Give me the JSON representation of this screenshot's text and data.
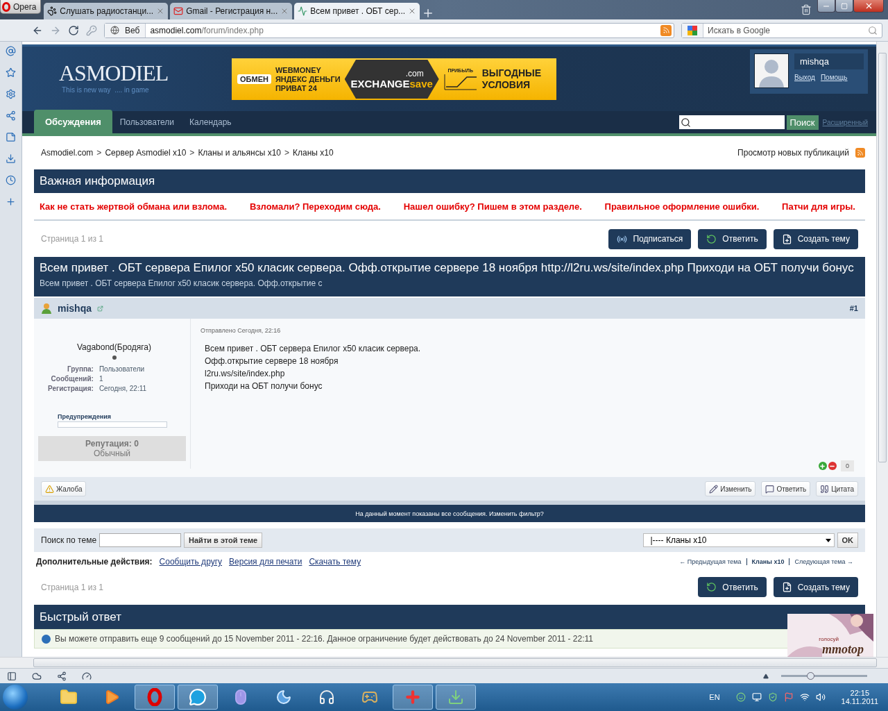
{
  "browser": {
    "opera_label": "Opera",
    "tabs": [
      {
        "title": "Слушать радиостанци...",
        "selected": false
      },
      {
        "title": "Gmail - Регистрация н...",
        "selected": false
      },
      {
        "title": "Всем привет . ОБТ сер...",
        "selected": true
      }
    ],
    "address": {
      "scope": "Веб",
      "domain": "asmodiel.com",
      "path": "/forum/index.php"
    },
    "search_placeholder": "Искать в Google"
  },
  "header": {
    "logo": "ASMODIEL",
    "tagline": "This is new way  .... in game",
    "banner": {
      "tag": "ОБМЕН",
      "lines": [
        "WEBMONEY",
        "ЯНДЕКС ДЕНЬГИ",
        "ПРИВАТ 24"
      ],
      "com": ".com",
      "brand": "EXCHANGE",
      "brand_accent": "save",
      "chart_label": "ПРИБЫЛЬ",
      "offer": [
        "ВЫГОДНЫЕ",
        "УСЛОВИЯ"
      ]
    },
    "user": {
      "name": "mishqa",
      "links": [
        "Выход",
        "Помощь"
      ]
    }
  },
  "nav": {
    "tabs": [
      {
        "label": "Обсуждения",
        "selected": true
      },
      {
        "label": "Пользователи",
        "selected": false
      },
      {
        "label": "Календарь",
        "selected": false
      }
    ],
    "search_button": "Поиск",
    "advanced": "Расширенный"
  },
  "breadcrumbs": [
    {
      "label": "Asmodiel.com"
    },
    {
      "separator": ">",
      "label": "Сервер Asmodiel x10"
    },
    {
      "separator": ">",
      "label": "Кланы и альянсы x10"
    },
    {
      "separator": ">",
      "label": "Кланы x10"
    }
  ],
  "new_posts": "Просмотр новых публикаций",
  "important": {
    "title": "Важная информация",
    "links": [
      "Как не стать жертвой обмана или взлома.",
      "Взломали? Переходим сюда.",
      "Нашел ошибку? Пишем в этом разделе.",
      "Правильное оформление ошибки.",
      "Патчи для игры."
    ]
  },
  "pagination_top": "Страница 1 из 1",
  "top_buttons": [
    {
      "kind": "subscribe",
      "label": "Подписаться"
    },
    {
      "kind": "reply",
      "label": "Ответить"
    },
    {
      "kind": "new",
      "label": "Создать тему"
    }
  ],
  "topic": {
    "title": "Всем привет . ОБТ сервера Епилог х50 класик сервера. Офф.открытие сервере 18 ноября http://l2ru.ws/site/index.php Приходи на ОБТ получи бонус",
    "description": "Всем привет . ОБТ сервера Епилог х50 класик сервера. Офф.открытие с"
  },
  "post": {
    "author": "mishqa",
    "number": "#1",
    "rank": "Vagabond(Бродяга)",
    "fields": [
      {
        "label": "Группа:",
        "value": "Пользователи"
      },
      {
        "label": "Сообщений:",
        "value": "1"
      },
      {
        "label": "Регистрация:",
        "value": "Сегодня, 22:11"
      }
    ],
    "warnings": {
      "label": "Предупреждения",
      "level": 0
    },
    "reputation": "Репутация: 0",
    "reputation_rank": "Обычный",
    "posted": "Отправлено Сегодня, 22:16",
    "body": [
      "Всем привет . ОБТ сервера Епилог х50 класик сервера.",
      "Офф.открытие сервере 18 ноября",
      "l2ru.ws/site/index.php",
      "Приходи на ОБТ получи бонус"
    ],
    "rating": "0",
    "report": "Жалоба",
    "actions": [
      {
        "kind": "edit",
        "label": "Изменить"
      },
      {
        "kind": "reply",
        "label": "Ответить"
      },
      {
        "kind": "quote",
        "label": "Цитата"
      }
    ]
  },
  "filter_notice": "На данный момент показаны все сообщения. Изменить фильтр?",
  "topic_search": {
    "label": "Поиск по теме",
    "button": "Найти в этой теме"
  },
  "jump": {
    "value": "|---- Кланы x10",
    "button": "OK"
  },
  "extra": {
    "label": "Дополнительные действия:",
    "links": [
      "Сообщить другу",
      "Версия для печати",
      "Скачать тему"
    ]
  },
  "topic_nav": [
    {
      "label": "← Предыдущая тема",
      "current": false
    },
    {
      "label": "Кланы x10",
      "current": true
    },
    {
      "label": "Следующая тема →",
      "current": false
    }
  ],
  "pagination_bottom": "Страница 1 из 1",
  "bottom_buttons": [
    {
      "kind": "reply",
      "label": "Ответить"
    },
    {
      "kind": "new",
      "label": "Создать тему"
    }
  ],
  "quick_reply": {
    "title": "Быстрый ответ",
    "notice": "Вы можете отправить еще 9 сообщений до 15 November 2011 - 22:16. Данное ограничение будет действовать до 24 November 2011 - 22:11"
  },
  "ad": {
    "vote": "голосуй",
    "brand": "mmotop"
  },
  "status_bar": {
    "zoom": {
      "level": 0.34
    }
  },
  "taskbar": {
    "language": "EN",
    "time": "22:15",
    "date": "14.11.2011"
  }
}
